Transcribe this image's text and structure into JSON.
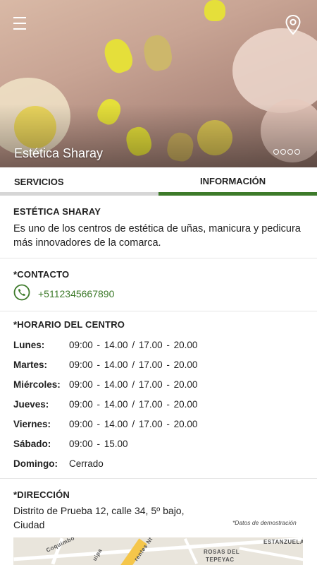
{
  "hero": {
    "title": "Estética Sharay",
    "menu_icon": "hamburger-menu-icon",
    "location_icon": "map-pin-icon",
    "slide_count": 4
  },
  "tabs": [
    {
      "label": "SERVICIOS",
      "active": false
    },
    {
      "label": "INFORMACIÓN",
      "active": true
    }
  ],
  "about": {
    "title": "ESTÉTICA SHARAY",
    "description": "Es uno de los centros de estética de uñas, manicura y pedicura más innovadores de la comarca."
  },
  "contact": {
    "title": "*CONTACTO",
    "phone": "+5112345667890",
    "icon": "phone-icon"
  },
  "hours": {
    "title": "*HORARIO DEL CENTRO",
    "rows": [
      {
        "day": "Lunes:",
        "time": "09:00 - 14.00  /  17.00 - 20.00"
      },
      {
        "day": "Martes:",
        "time": "09:00 - 14.00  /  17.00 - 20.00"
      },
      {
        "day": "Miércoles:",
        "time": "09:00 - 14.00  /  17.00 - 20.00"
      },
      {
        "day": "Jueves:",
        "time": "09:00 - 14.00  /  17.00 - 20.00"
      },
      {
        "day": "Viernes:",
        "time": "09:00 - 14.00  /  17.00 - 20.00"
      },
      {
        "day": "Sábado:",
        "time": "09:00 - 15.00"
      },
      {
        "day": "Domingo:",
        "time": "Cerrado"
      }
    ]
  },
  "address": {
    "title": "*DIRECCIÓN",
    "text": "Distrito de Prueba 12, calle 34, 5º bajo, Ciudad",
    "note": "*Datos de demostración"
  },
  "map": {
    "labels": [
      "Coquimbo",
      "ROSAS DEL",
      "TEPEYAC",
      "ESTANZUELA",
      "rentes Nt",
      "uipa"
    ]
  },
  "colors": {
    "accent": "#3d7a2a",
    "tab_inactive_bar": "#d6d6d6"
  }
}
